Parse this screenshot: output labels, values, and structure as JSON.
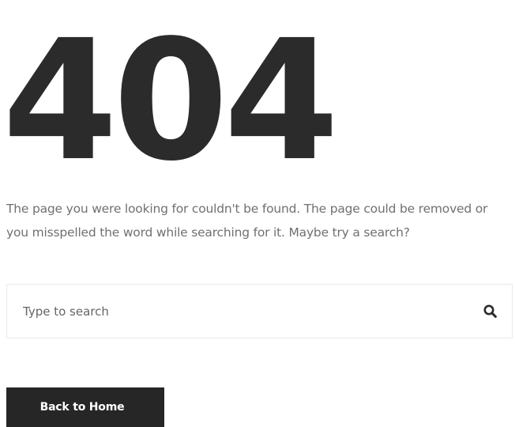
{
  "error": {
    "code": "404",
    "message": "The page you were looking for couldn't be found. The page could be removed or you misspelled the word while searching for it. Maybe try a search?"
  },
  "search": {
    "placeholder": "Type to search",
    "value": "",
    "icon": "search-icon"
  },
  "actions": {
    "back_home_label": "Back to Home"
  },
  "colors": {
    "heading": "#2b2b2b",
    "text": "#707070",
    "button_bg": "#262626",
    "button_text": "#ffffff",
    "border": "#e9e9e9"
  }
}
